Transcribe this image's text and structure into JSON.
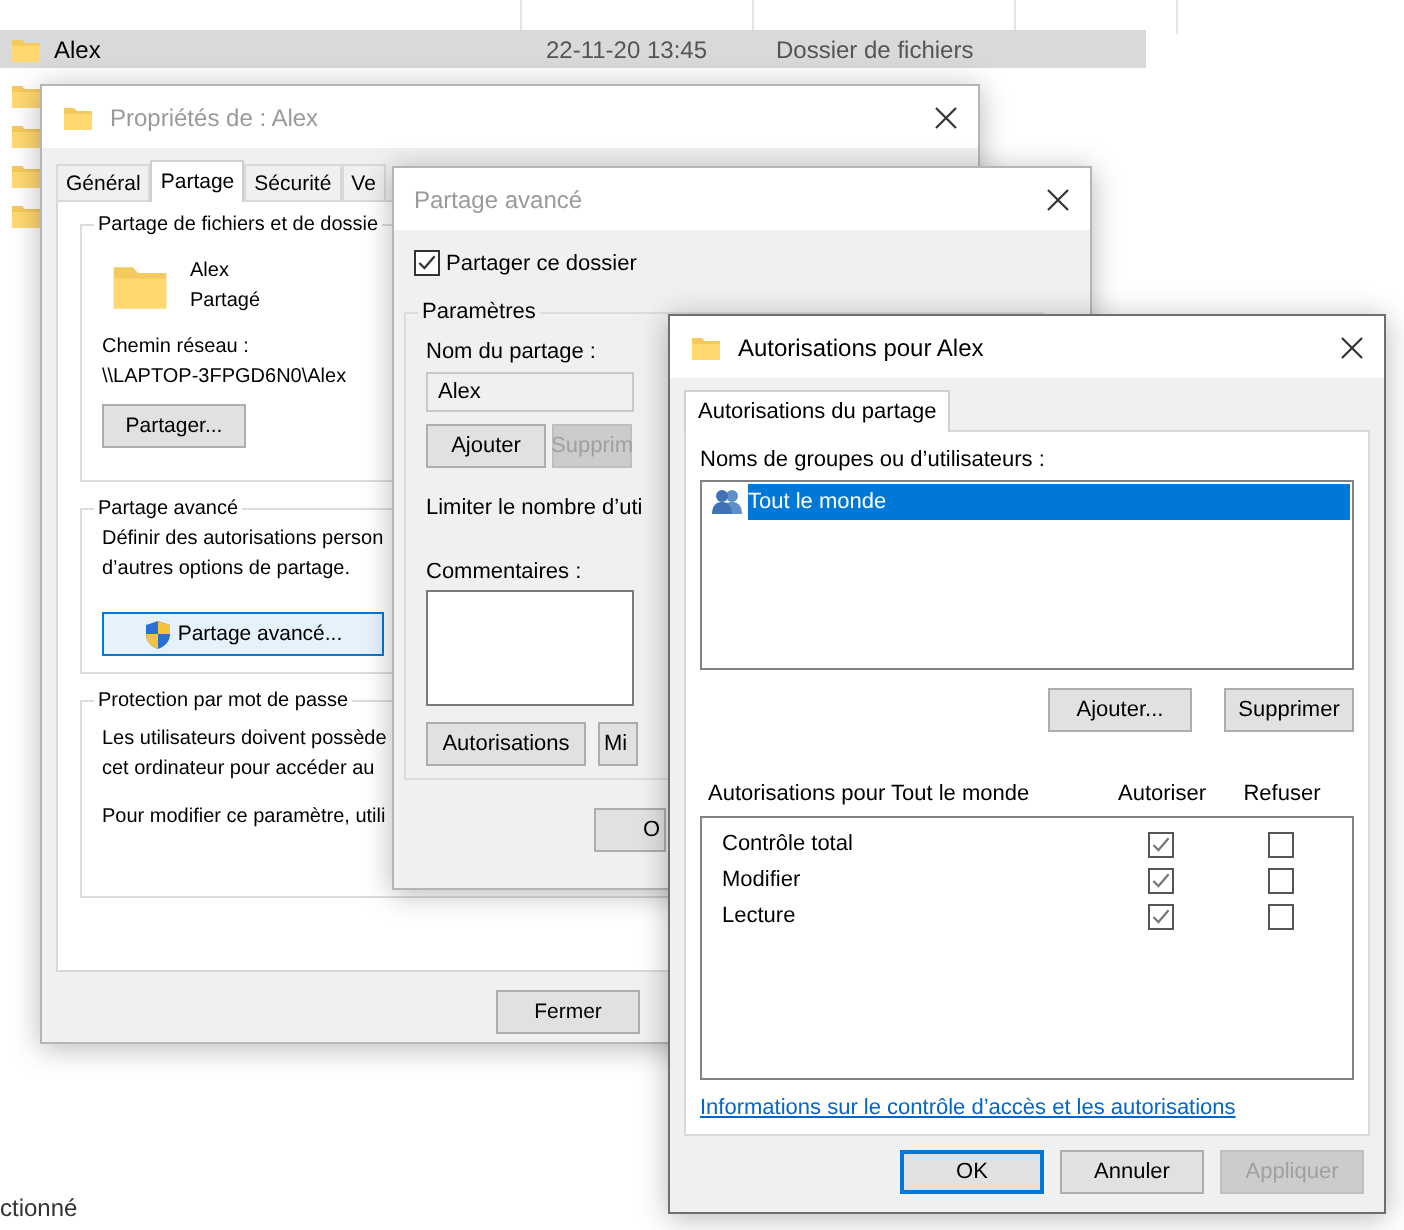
{
  "explorer": {
    "rows": [
      {
        "name": "Alex",
        "date": "22-11-20 13:45",
        "type": "Dossier de fichiers",
        "selected": true
      }
    ],
    "status_bar": "ctionné"
  },
  "properties_window": {
    "title": "Propriétés de : Alex",
    "active": false,
    "tabs": [
      {
        "label": "Général",
        "selected": false
      },
      {
        "label": "Partage",
        "selected": true
      },
      {
        "label": "Sécurité",
        "selected": false
      },
      {
        "label": "Ve",
        "selected": false
      }
    ],
    "sharing_group": {
      "title": "Partage de fichiers et de dossie",
      "folder_name": "Alex",
      "status": "Partagé",
      "path_label": "Chemin réseau :",
      "path": "\\\\LAPTOP-3FPGD6N0\\Alex",
      "button": "Partager..."
    },
    "advanced_group": {
      "title": "Partage avancé",
      "lines": [
        "Définir des autorisations person",
        "d’autres options de partage."
      ],
      "button": "Partage avancé..."
    },
    "password_group": {
      "title": "Protection par mot de passe",
      "lines": [
        "Les utilisateurs doivent possède",
        "cet ordinateur pour accéder au"
      ],
      "note": "Pour modifier ce paramètre, utili"
    },
    "buttons": [
      "Fermer"
    ]
  },
  "advanced_window": {
    "title": "Partage avancé",
    "active": false,
    "share_checkbox": {
      "label": "Partager ce dossier",
      "checked": true
    },
    "settings_group": {
      "title": "Paramètres",
      "name_label": "Nom du partage :",
      "name_value": "Alex",
      "name_buttons": [
        {
          "label": "Ajouter",
          "disabled": false
        },
        {
          "label": "Supprim",
          "disabled": true
        }
      ],
      "limit_label": "Limiter le nombre d’uti",
      "comments_label": "Commentaires :",
      "buttons": [
        "Autorisations",
        "Mi"
      ]
    },
    "buttons": [
      "O"
    ]
  },
  "permissions_window": {
    "title": "Autorisations pour Alex",
    "active": true,
    "tabs": [
      {
        "label": "Autorisations du partage",
        "selected": true
      }
    ],
    "groups_label": "Noms de groupes ou d’utilisateurs :",
    "groups": [
      {
        "name": "Tout le monde",
        "selected": true
      }
    ],
    "group_buttons": [
      "Ajouter...",
      "Supprimer"
    ],
    "permissions_label": "Autorisations pour Tout le monde",
    "columns": [
      "Autoriser",
      "Refuser"
    ],
    "permissions": [
      {
        "name": "Contrôle total",
        "allow": true,
        "deny": false
      },
      {
        "name": "Modifier",
        "allow": true,
        "deny": false
      },
      {
        "name": "Lecture",
        "allow": true,
        "deny": false
      }
    ],
    "link": "Informations sur le contrôle d’accès et les autorisations",
    "buttons": [
      {
        "label": "OK",
        "default": true,
        "disabled": false
      },
      {
        "label": "Annuler",
        "default": false,
        "disabled": false
      },
      {
        "label": "Appliquer",
        "default": false,
        "disabled": true
      }
    ]
  }
}
